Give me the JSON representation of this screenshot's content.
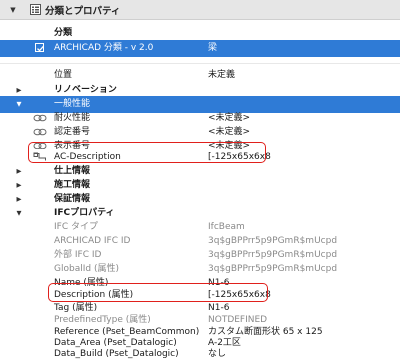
{
  "header": {
    "title": "分類とプロパティ",
    "caret": "▼"
  },
  "classification": {
    "section_label": "分類",
    "system_label": "ARCHICAD 分類 - v 2.0",
    "system_value": "梁"
  },
  "position": {
    "label": "位置",
    "value": "未定義"
  },
  "renovation": {
    "label": "リノベーション"
  },
  "general": {
    "label": "一般性能",
    "items": [
      {
        "label": "耐火性能",
        "value": "<未定義>"
      },
      {
        "label": "認定番号",
        "value": "<未定義>"
      },
      {
        "label": "表示番号",
        "value": "<未定義>"
      },
      {
        "label": "AC-Description",
        "value": "[-125x65x6x8"
      }
    ]
  },
  "groups": [
    {
      "label": "仕上情報"
    },
    {
      "label": "施工情報"
    },
    {
      "label": "保証情報"
    }
  ],
  "ifc": {
    "label": "IFCプロパティ",
    "items": [
      {
        "label": "IFC タイプ",
        "value": "IfcBeam"
      },
      {
        "label": "ARCHICAD IFC ID",
        "value": "3q$gBPPrr5p9PGmR$mUcpd"
      },
      {
        "label": "外部 IFC ID",
        "value": "3q$gBPPrr5p9PGmR$mUcpd"
      },
      {
        "label": "GlobalId (属性)",
        "value": "3q$gBPPrr5p9PGmR$mUcpd"
      },
      {
        "label": "Name (属性)",
        "value": "N1-6"
      },
      {
        "label": "Description (属性)",
        "value": "[-125x65x6x8"
      },
      {
        "label": "Tag (属性)",
        "value": "N1-6"
      },
      {
        "label": "PredefinedType (属性)",
        "value": "NOTDEFINED"
      },
      {
        "label": "Reference (Pset_BeamCommon)",
        "value": "カスタム断面形状 65 x 125"
      },
      {
        "label": "Data_Area (Pset_Datalogic)",
        "value": "A-2工区"
      },
      {
        "label": "Data_Build (Pset_Datalogic)",
        "value": "なし"
      }
    ]
  },
  "colors": {
    "selection": "#2f7bd6",
    "highlight": "#e0201c",
    "header_bg": "#e6e6e6"
  }
}
